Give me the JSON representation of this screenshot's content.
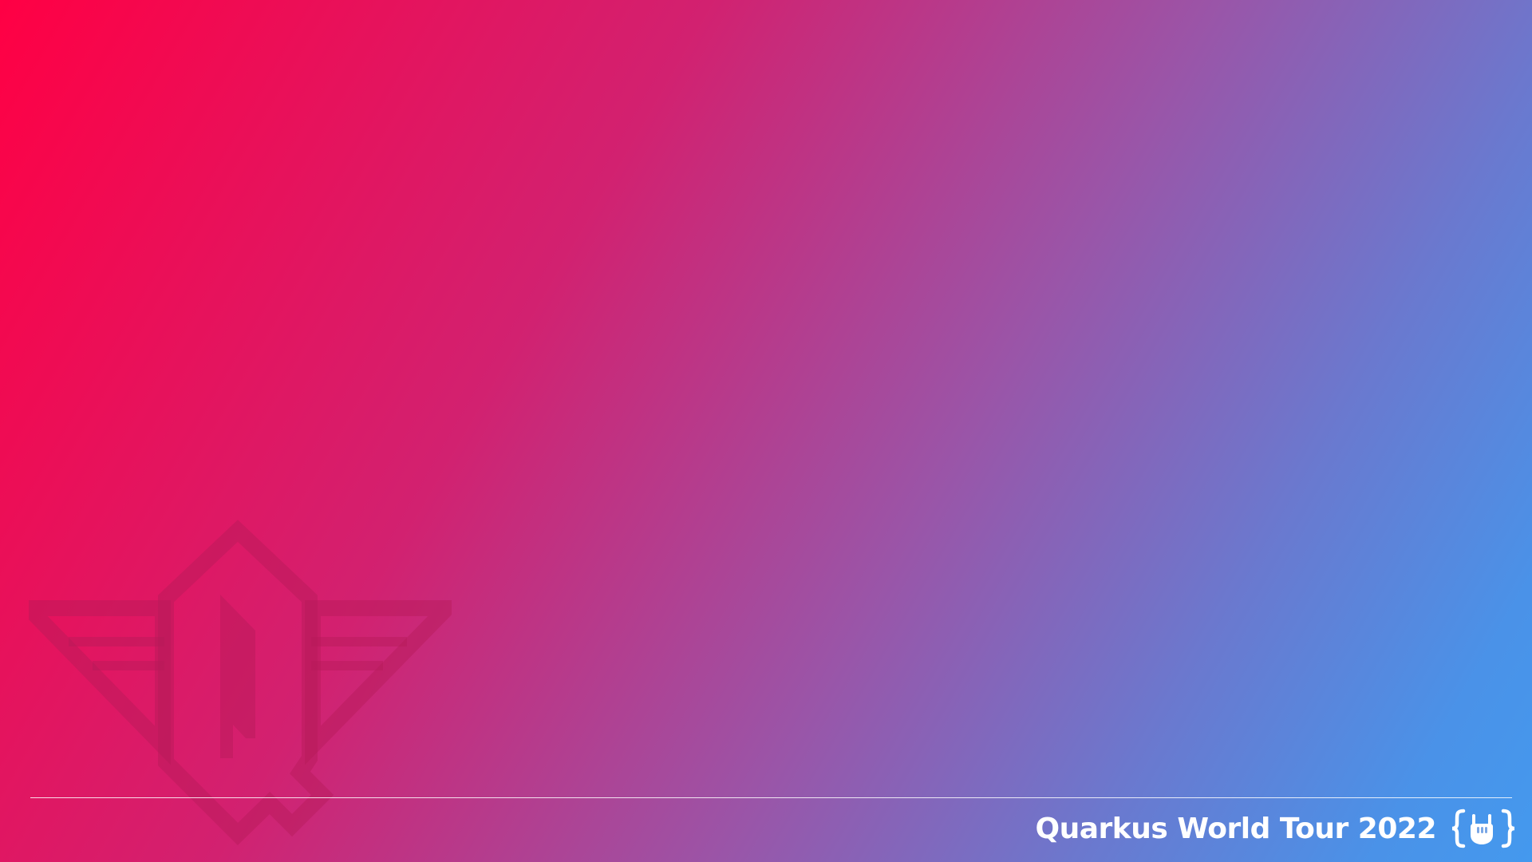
{
  "slide": {
    "footer_title": "Quarkus World Tour 2022",
    "emblem_icon": "quarkus-wings-q-emblem",
    "logo_icon": "quarkus-rock-hand-logo",
    "colors": {
      "gradient_start": "#ff0044",
      "gradient_mid": "#9a55a8",
      "gradient_end": "#4499ee",
      "emblem_tint": "#b01a55",
      "footer_text": "#ffffff"
    }
  }
}
